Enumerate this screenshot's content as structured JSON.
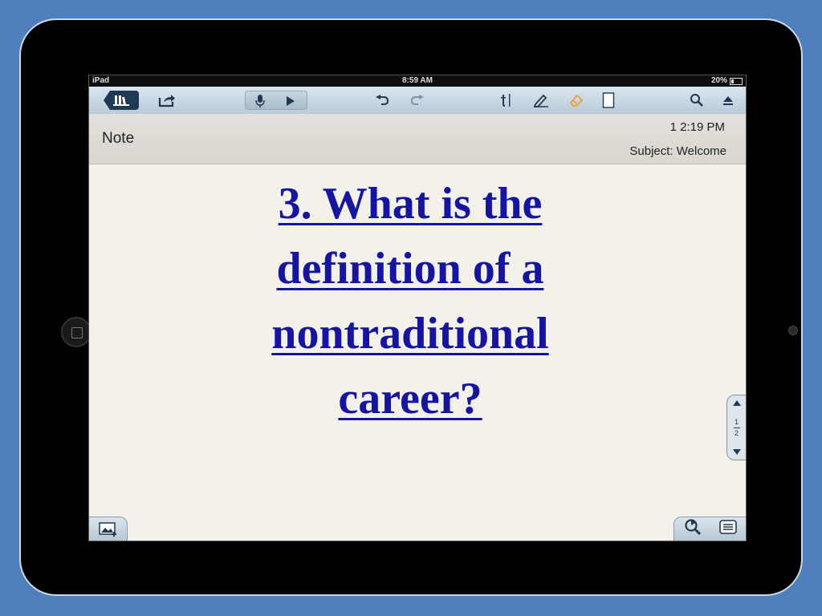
{
  "status_bar": {
    "device": "iPad",
    "time": "8:59 AM",
    "battery": "20%"
  },
  "toolbar": {
    "library_icon": "library-books-icon",
    "share_icon": "share-arrow-icon",
    "mic_icon": "microphone-icon",
    "play_icon": "play-icon",
    "undo_icon": "undo-icon",
    "redo_icon": "redo-icon",
    "text_tool_icon": "text-cursor-icon",
    "pen_icon": "pen-icon",
    "eraser_icon": "eraser-icon",
    "page_icon": "blank-page-icon",
    "search_icon": "search-icon",
    "eject_icon": "eject-icon"
  },
  "note": {
    "title": "Note",
    "time": "1 2:19 PM",
    "subject": "Subject: Welcome"
  },
  "content": {
    "question_lines": [
      "3. What is the",
      "definition of a",
      "nontraditional",
      "career?"
    ]
  },
  "pager": {
    "current": "1",
    "total": "2"
  },
  "bottom": {
    "add_image_icon": "add-image-icon",
    "zoom_icon": "zoom-icon",
    "menu_icon": "list-menu-icon"
  },
  "colors": {
    "question_text": "#1515a5",
    "device_frame": "#000000",
    "background": "#4f7fbd"
  }
}
